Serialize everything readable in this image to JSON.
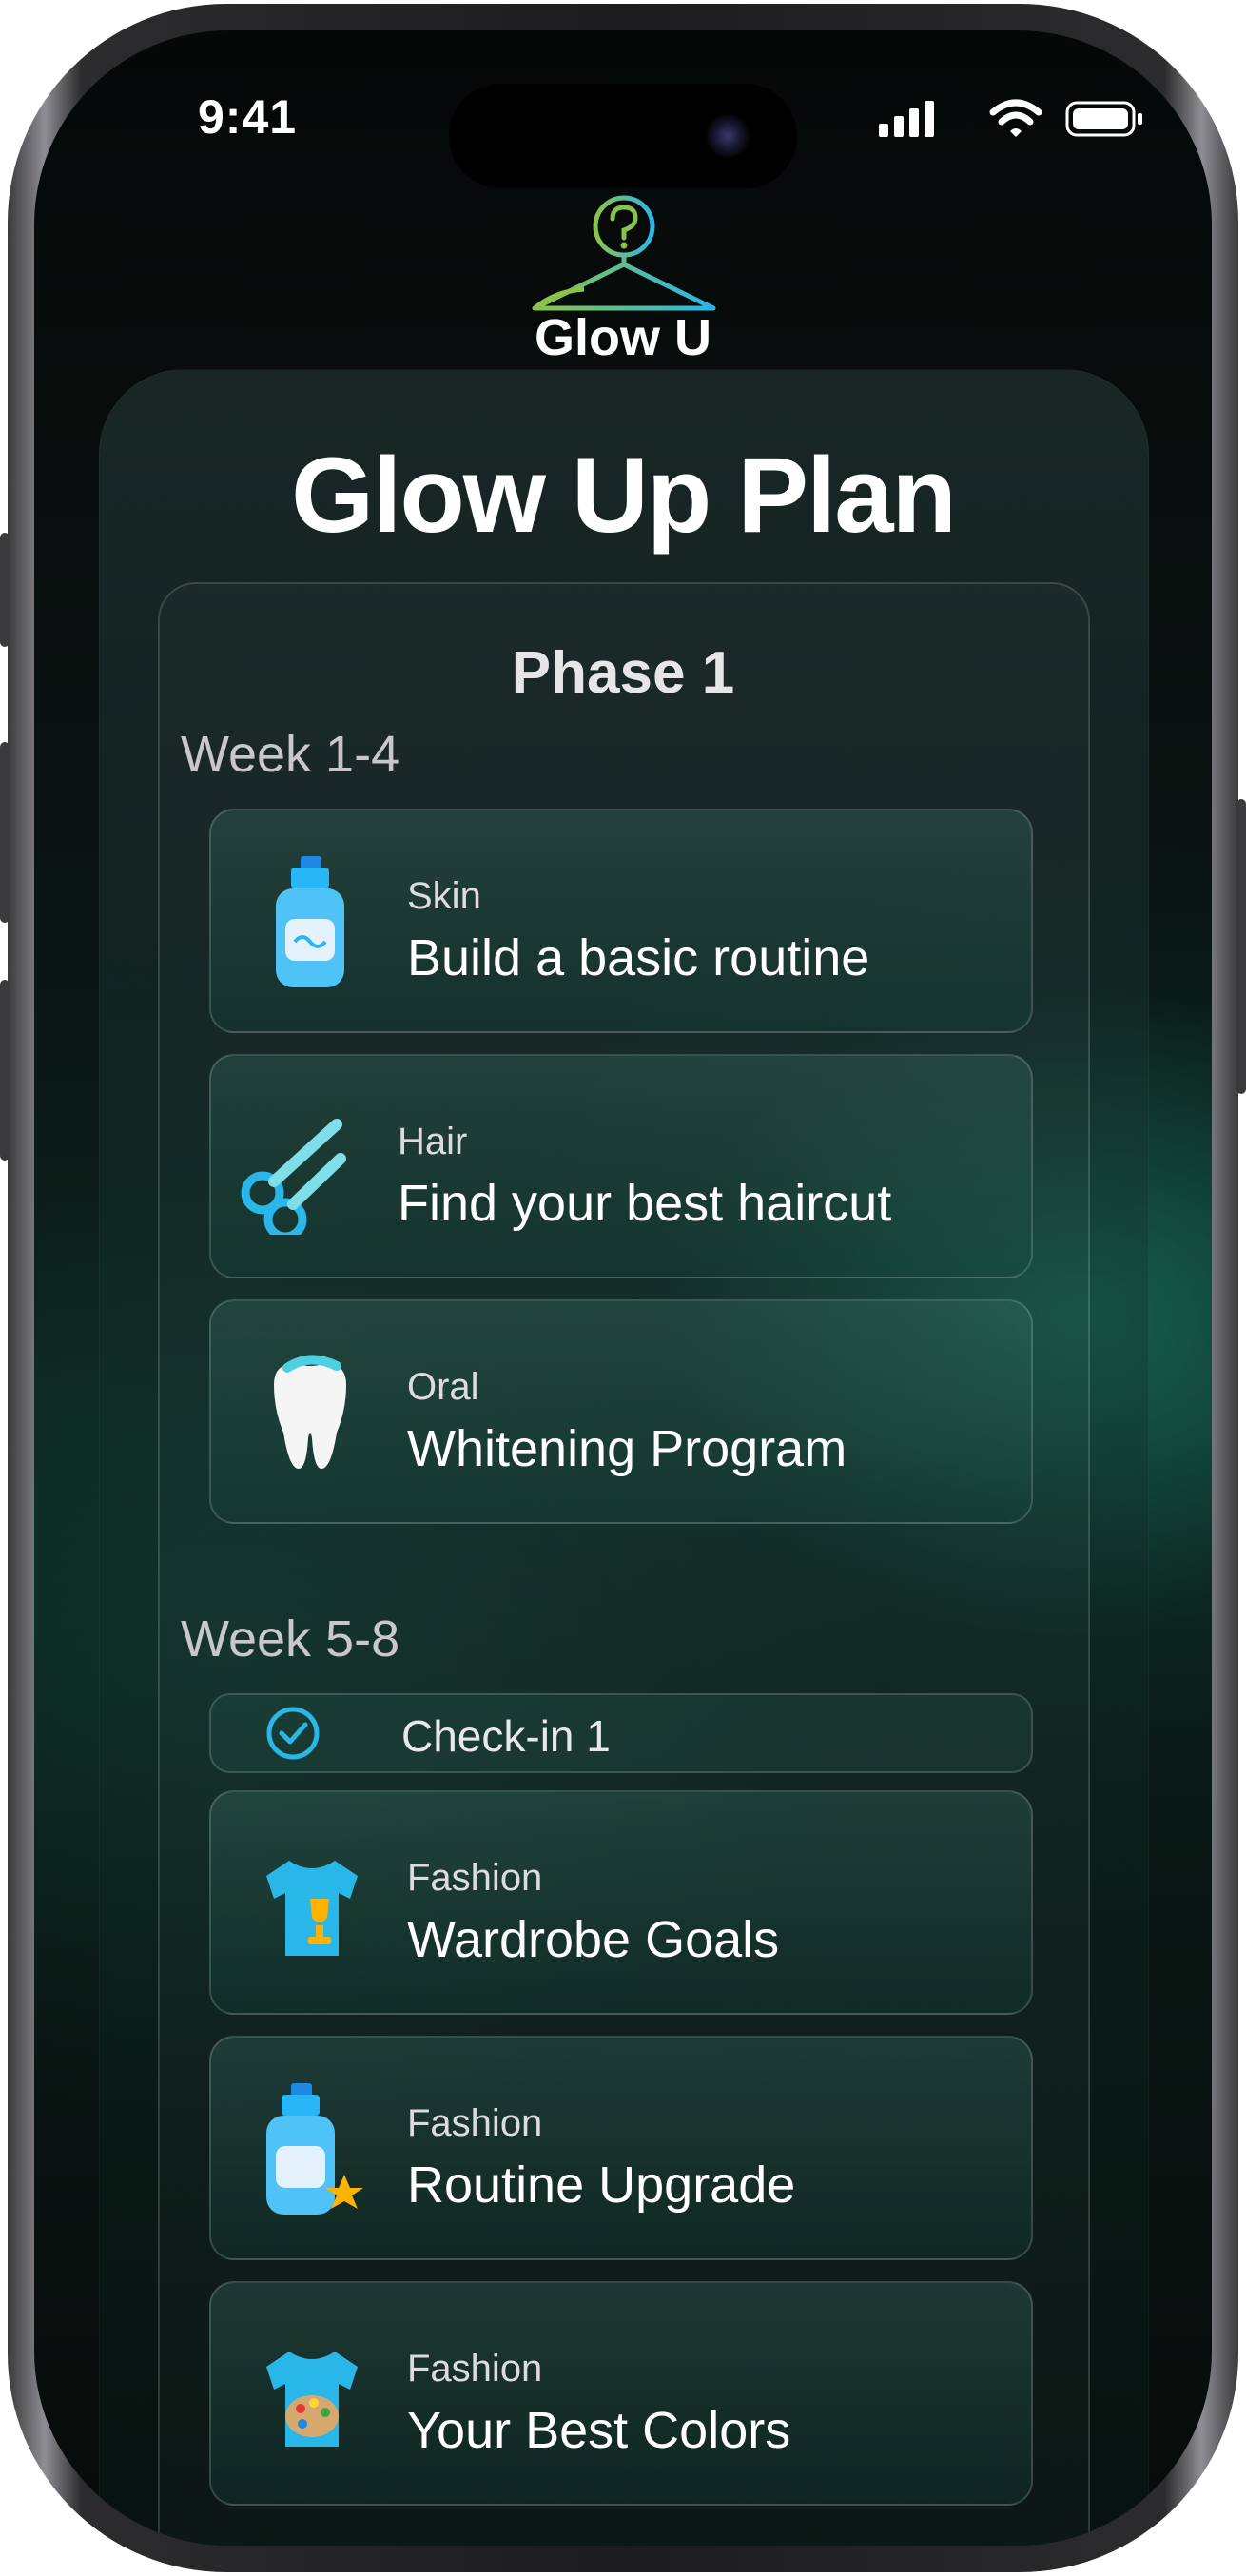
{
  "status_bar": {
    "time": "9:41"
  },
  "brand": {
    "name": "Glow U",
    "logo_icon": "hanger-question-icon"
  },
  "page": {
    "title": "Glow Up Plan",
    "phase_title": "Phase 1"
  },
  "weeks": [
    {
      "label": "Week 1-4",
      "tasks": [
        {
          "category": "Skin",
          "title": "Build a basic routine",
          "icon": "cleanser-bottle-icon"
        },
        {
          "category": "Hair",
          "title": "Find your best haircut",
          "icon": "scissors-icon"
        },
        {
          "category": "Oral",
          "title": "Whitening Program",
          "icon": "tooth-icon"
        }
      ]
    },
    {
      "label": "Week 5-8",
      "checkin": {
        "label": "Check-in 1",
        "icon": "check-circle-icon"
      },
      "tasks": [
        {
          "category": "Fashion",
          "title": "Wardrobe Goals",
          "icon": "shirt-trophy-icon"
        },
        {
          "category": "Fashion",
          "title": "Routine Upgrade",
          "icon": "cleanser-star-icon"
        },
        {
          "category": "Fashion",
          "title": "Your Best Colors",
          "icon": "shirt-palette-icon"
        }
      ]
    }
  ],
  "colors": {
    "accent": "#29b6e8",
    "background": "#0a1613",
    "brand_gradient": [
      "#8bc34a",
      "#29b6e8"
    ]
  }
}
